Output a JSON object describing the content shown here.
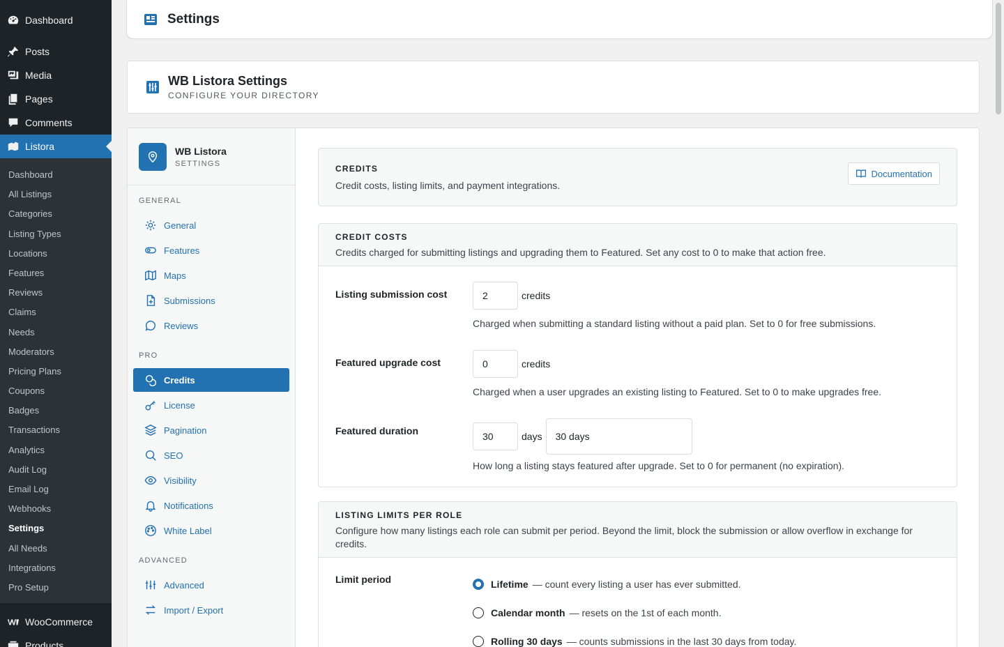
{
  "admin_menu": {
    "top_items": [
      {
        "label": "Dashboard",
        "icon": "dashboard-icon"
      },
      {
        "label": "Posts",
        "icon": "pin-icon"
      },
      {
        "label": "Media",
        "icon": "media-icon"
      },
      {
        "label": "Pages",
        "icon": "pages-icon"
      },
      {
        "label": "Comments",
        "icon": "comments-icon"
      },
      {
        "label": "Listora",
        "icon": "map-icon"
      }
    ],
    "sub_items": [
      "Dashboard",
      "All Listings",
      "Categories",
      "Listing Types",
      "Locations",
      "Features",
      "Reviews",
      "Claims",
      "Needs",
      "Moderators",
      "Pricing Plans",
      "Coupons",
      "Badges",
      "Transactions",
      "Analytics",
      "Audit Log",
      "Email Log",
      "Webhooks",
      "Settings",
      "All Needs",
      "Integrations",
      "Pro Setup"
    ],
    "bottom_items": [
      {
        "label": "WooCommerce",
        "icon": "woocommerce-icon"
      },
      {
        "label": "Products",
        "icon": "products-icon"
      }
    ]
  },
  "page_header": {
    "title": "Settings"
  },
  "plugin_header": {
    "title": "WB Listora Settings",
    "subtitle": "CONFIGURE YOUR DIRECTORY"
  },
  "settings_nav": {
    "brand_title": "WB Listora",
    "brand_subtitle": "SETTINGS",
    "sections": [
      {
        "label": "GENERAL",
        "items": [
          "General",
          "Features",
          "Maps",
          "Submissions",
          "Reviews"
        ]
      },
      {
        "label": "PRO",
        "items": [
          "Credits",
          "License",
          "Pagination",
          "SEO",
          "Visibility",
          "Notifications",
          "White Label"
        ]
      },
      {
        "label": "ADVANCED",
        "items": [
          "Advanced",
          "Import / Export"
        ]
      }
    ],
    "active": "Credits"
  },
  "credits_card": {
    "title": "CREDITS",
    "description": "Credit costs, listing limits, and payment integrations.",
    "doc_button": "Documentation"
  },
  "credit_costs": {
    "title": "CREDIT COSTS",
    "description": "Credits charged for submitting listings and upgrading them to Featured. Set any cost to 0 to make that action free.",
    "rows": [
      {
        "label": "Listing submission cost",
        "value": "2",
        "unit": "credits",
        "help": "Charged when submitting a standard listing without a paid plan. Set to 0 for free submissions."
      },
      {
        "label": "Featured upgrade cost",
        "value": "0",
        "unit": "credits",
        "help": "Charged when a user upgrades an existing listing to Featured. Set to 0 to make upgrades free."
      },
      {
        "label": "Featured duration",
        "value": "30",
        "unit": "days",
        "select": "30 days",
        "help": "How long a listing stays featured after upgrade. Set to 0 for permanent (no expiration)."
      }
    ]
  },
  "listing_limits": {
    "title": "LISTING LIMITS PER ROLE",
    "description": "Configure how many listings each role can submit per period. Beyond the limit, block the submission or allow overflow in exchange for credits.",
    "limit_label": "Limit period",
    "options": [
      {
        "label": "Lifetime",
        "desc": "— count every listing a user has ever submitted.",
        "selected": true
      },
      {
        "label": "Calendar month",
        "desc": "— resets on the 1st of each month.",
        "selected": false
      },
      {
        "label": "Rolling 30 days",
        "desc": "— counts submissions in the last 30 days from today.",
        "selected": false
      }
    ]
  },
  "colors": {
    "accent": "#2271b1",
    "admin_bg": "#1d2327"
  }
}
